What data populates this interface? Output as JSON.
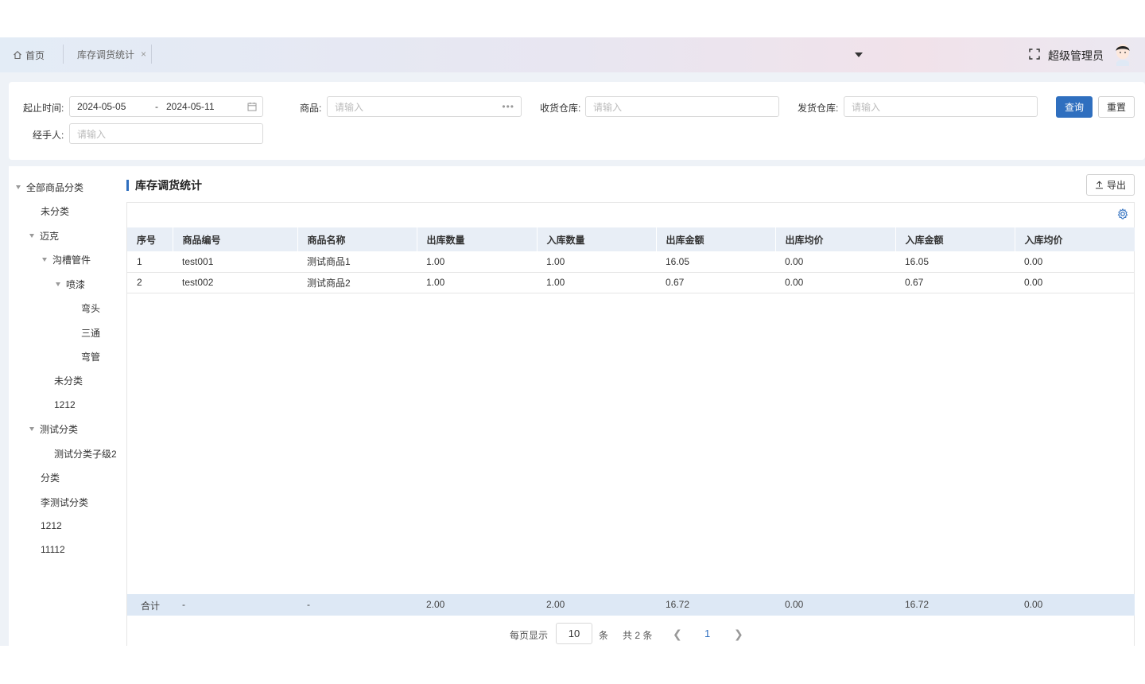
{
  "header": {
    "home_tab": "首页",
    "active_tab": "库存调货统计",
    "close_symbol": "×",
    "username": "超级管理员"
  },
  "search": {
    "date_label": "起止时间:",
    "date_start": "2024-05-05",
    "date_sep": "-",
    "date_end": "2024-05-11",
    "product_label": "商品:",
    "product_placeholder": "请输入",
    "receive_wh_label": "收货仓库:",
    "receive_wh_placeholder": "请输入",
    "send_wh_label": "发货仓库:",
    "send_wh_placeholder": "请输入",
    "handler_label": "经手人:",
    "handler_placeholder": "请输入",
    "query_button": "查询",
    "reset_button": "重置"
  },
  "tree": [
    {
      "label": "全部商品分类",
      "expanded": true
    },
    {
      "label": "未分类"
    },
    {
      "label": "迈克",
      "expanded": true
    },
    {
      "label": "沟槽管件",
      "expanded": true
    },
    {
      "label": "喷漆",
      "expanded": true
    },
    {
      "label": "弯头"
    },
    {
      "label": "三通"
    },
    {
      "label": "弯管"
    },
    {
      "label": "未分类"
    },
    {
      "label": "1212"
    },
    {
      "label": "测试分类",
      "expanded": true
    },
    {
      "label": "测试分类子级2"
    },
    {
      "label": "分类"
    },
    {
      "label": "李测试分类"
    },
    {
      "label": "1212"
    },
    {
      "label": "11112"
    }
  ],
  "main": {
    "title": "库存调货统计",
    "export_button": "导出",
    "columns": [
      "序号",
      "商品编号",
      "商品名称",
      "出库数量",
      "入库数量",
      "出库金额",
      "出库均价",
      "入库金额",
      "入库均价"
    ],
    "rows": [
      [
        "1",
        "test001",
        "测试商品1",
        "1.00",
        "1.00",
        "16.05",
        "0.00",
        "16.05",
        "0.00"
      ],
      [
        "2",
        "test002",
        "测试商品2",
        "1.00",
        "1.00",
        "0.67",
        "0.00",
        "0.67",
        "0.00"
      ]
    ],
    "summary": [
      "合计",
      "-",
      "-",
      "2.00",
      "2.00",
      "16.72",
      "0.00",
      "16.72",
      "0.00"
    ]
  },
  "pager": {
    "per_page_label": "每页显示",
    "page_size": "10",
    "unit": "条",
    "total_text": "共 2 条",
    "current_page": "1"
  },
  "colors": {
    "primary": "#2f6fbf",
    "header_row": "#e8eef6",
    "summary_row": "#dde8f5"
  }
}
